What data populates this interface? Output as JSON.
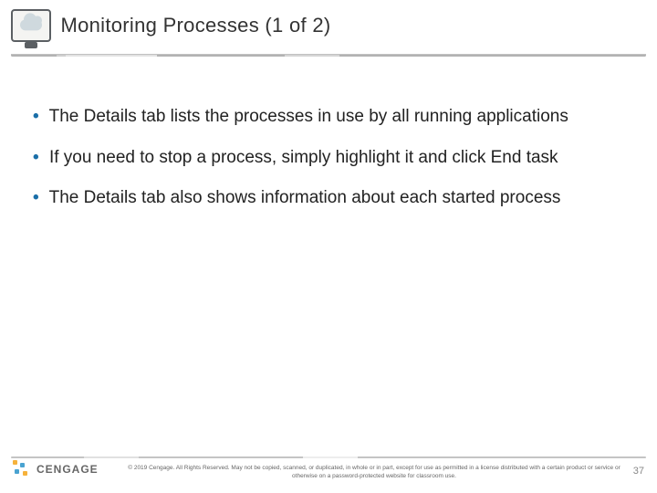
{
  "header": {
    "title": "Monitoring Processes (1 of 2)",
    "icon": "cloud-monitor-icon"
  },
  "bullets": [
    "The Details tab lists the processes in use by all running applications",
    "If you need to stop a process, simply highlight it and click End task",
    "The Details tab also shows information about each started process"
  ],
  "footer": {
    "brand": "CENGAGE",
    "copyright": "© 2019 Cengage. All Rights Reserved. May not be copied, scanned, or duplicated, in whole or in part, except for use as permitted in a license distributed with a certain product or service or otherwise on a password-protected website for classroom use.",
    "page_number": "37"
  }
}
